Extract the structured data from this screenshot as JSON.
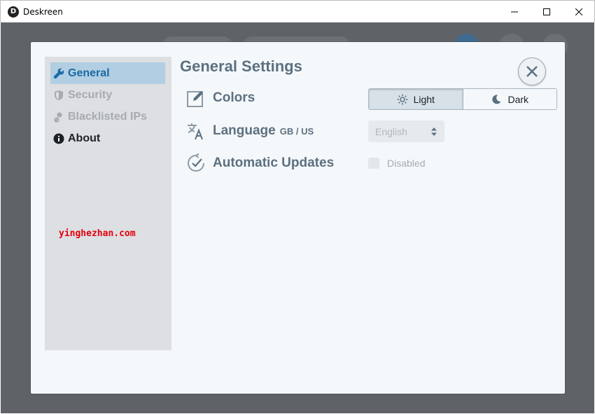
{
  "window": {
    "title": "Deskreen",
    "icon_letter": "D"
  },
  "sidebar": {
    "items": [
      {
        "label": "General",
        "icon": "wrench-icon",
        "state": "active"
      },
      {
        "label": "Security",
        "icon": "shield-icon",
        "state": "disabled"
      },
      {
        "label": "Blacklisted IPs",
        "icon": "user-blocked-icon",
        "state": "disabled"
      },
      {
        "label": "About",
        "icon": "info-icon",
        "state": "normal"
      }
    ],
    "watermark": "yinghezhan.com"
  },
  "main": {
    "title": "General Settings",
    "colors": {
      "label": "Colors",
      "options": [
        {
          "label": "Light",
          "icon": "sun-icon",
          "selected": true
        },
        {
          "label": "Dark",
          "icon": "moon-icon",
          "selected": false
        }
      ]
    },
    "language": {
      "label": "Language",
      "sub": "GB / US",
      "value": "English"
    },
    "updates": {
      "label": "Automatic Updates",
      "checkbox_label": "Disabled",
      "checked": false
    }
  },
  "colors": {
    "accent": "#1a6aa5",
    "text_muted": "#5c7080",
    "backdrop": "#5f6367"
  }
}
